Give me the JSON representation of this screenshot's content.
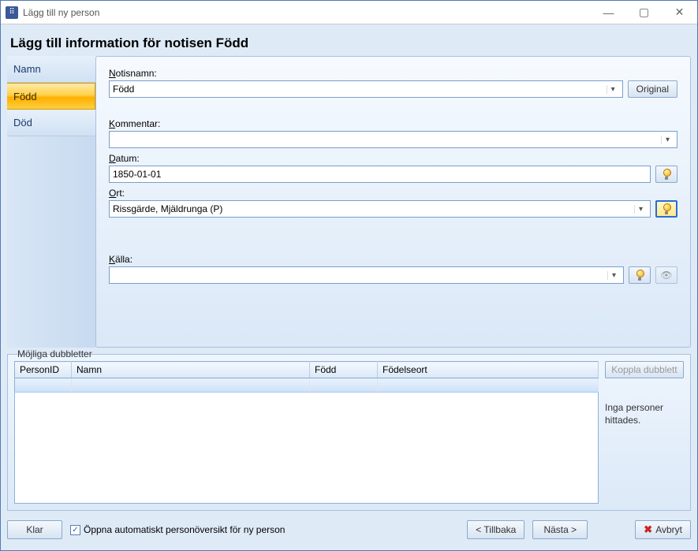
{
  "window": {
    "title": "Lägg till ny person"
  },
  "heading": "Lägg till information för notisen Född",
  "tabs": [
    {
      "label": "Namn"
    },
    {
      "label": "Född"
    },
    {
      "label": "Död"
    }
  ],
  "form": {
    "notisnamn_label_pre": "N",
    "notisnamn_label_rest": "otisnamn:",
    "notisnamn_value": "Född",
    "original_btn": "Original",
    "kommentar_label_pre": "K",
    "kommentar_label_rest": "ommentar:",
    "kommentar_value": "",
    "datum_label_pre": "D",
    "datum_label_rest": "atum:",
    "datum_value": "1850-01-01",
    "ort_label_pre": "O",
    "ort_label_rest": "rt:",
    "ort_value": "Rissgärde, Mjäldrunga (P)",
    "kalla_label_pre": "K",
    "kalla_label_rest": "älla:",
    "kalla_value": ""
  },
  "duplicates": {
    "legend": "Möjliga dubbletter",
    "columns": [
      "PersonID",
      "Namn",
      "Född",
      "Födelseort"
    ],
    "rows": [],
    "button": "Koppla dubblett",
    "message": "Inga personer hittades."
  },
  "footer": {
    "klar": "Klar",
    "checkbox": "Öppna automatiskt personöversikt för ny person",
    "checkbox_checked": true,
    "back": "< Tillbaka",
    "next": "Nästa >",
    "cancel": "Avbryt"
  }
}
